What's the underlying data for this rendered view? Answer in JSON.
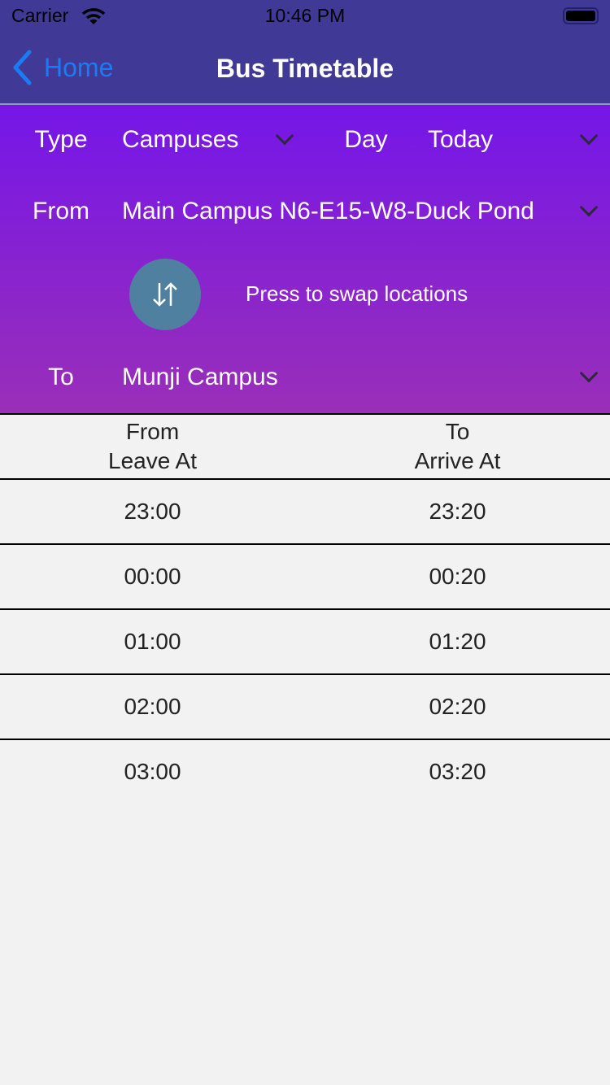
{
  "status_bar": {
    "carrier": "Carrier",
    "time": "10:46 PM",
    "icons": [
      "wifi-icon",
      "battery-icon"
    ]
  },
  "nav": {
    "back_label": "Home",
    "title": "Bus Timetable"
  },
  "form": {
    "type_label": "Type",
    "type_value": "Campuses",
    "day_label": "Day",
    "day_value": "Today",
    "from_label": "From",
    "from_value": "Main Campus N6-E15-W8-Duck Pond",
    "swap_hint": "Press to swap locations",
    "to_label": "To",
    "to_value": "Munji Campus"
  },
  "table": {
    "headers": [
      {
        "line1": "From",
        "line2": "Leave At"
      },
      {
        "line1": "To",
        "line2": "Arrive At"
      }
    ],
    "rows": [
      [
        "23:00",
        "23:20"
      ],
      [
        "00:00",
        "00:20"
      ],
      [
        "01:00",
        "01:20"
      ],
      [
        "02:00",
        "02:20"
      ],
      [
        "03:00",
        "03:20"
      ]
    ]
  },
  "colors": {
    "nav_bg": "#403a96",
    "back_link": "#1a7cf5",
    "gradient_top": "#7516e8",
    "gradient_bottom": "#9a2fb8",
    "swap_button": "#5080a0",
    "background": "#f2f2f2"
  }
}
